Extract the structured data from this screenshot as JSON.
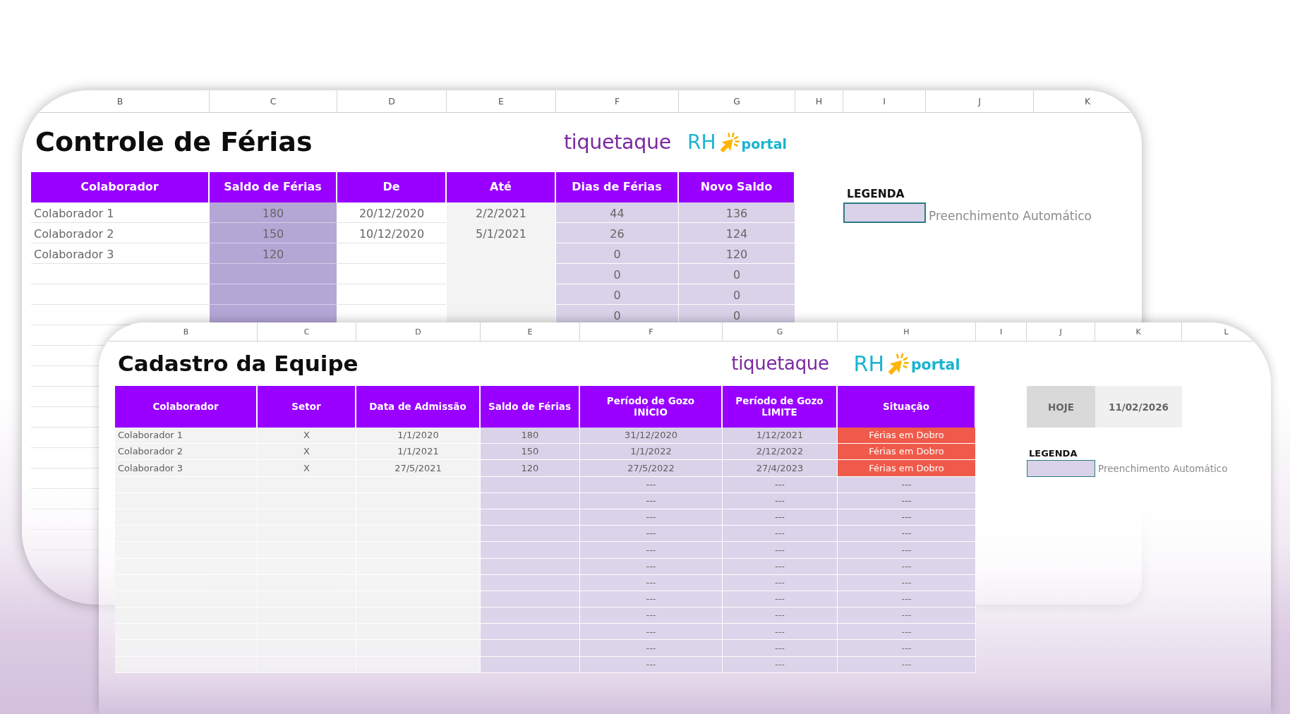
{
  "sheets": [
    {
      "kind": "vacation-balance",
      "column_letters": [
        "B",
        "C",
        "D",
        "E",
        "F",
        "G",
        "H",
        "I",
        "J",
        "K"
      ],
      "title": "Controle de Férias",
      "logos": [
        {
          "kind": "wordmark",
          "text": "tiquetaque"
        },
        {
          "kind": "badge",
          "prefix": "RH",
          "suffix": "portal"
        }
      ],
      "table": {
        "columns": [
          {
            "label": "Colaborador",
            "kind": "plain"
          },
          {
            "label": "Saldo de Férias",
            "kind": "input"
          },
          {
            "label": "De",
            "kind": "plain"
          },
          {
            "label": "Até",
            "kind": "muted"
          },
          {
            "label": "Dias de Férias",
            "kind": "auto"
          },
          {
            "label": "Novo Saldo",
            "kind": "auto"
          }
        ],
        "rows": [
          {
            "cells": [
              "Colaborador 1",
              "180",
              "20/12/2020",
              "2/2/2021",
              "44",
              "136"
            ]
          },
          {
            "cells": [
              "Colaborador 2",
              "150",
              "10/12/2020",
              "5/1/2021",
              "26",
              "124"
            ]
          },
          {
            "cells": [
              "Colaborador 3",
              "120",
              null,
              null,
              "0",
              "120"
            ]
          },
          {
            "cells": [
              null,
              null,
              null,
              null,
              "0",
              "0"
            ]
          },
          {
            "cells": [
              null,
              null,
              null,
              null,
              "0",
              "0"
            ]
          },
          {
            "cells": [
              null,
              null,
              null,
              null,
              "0",
              "0"
            ]
          }
        ]
      },
      "legend": {
        "title": "LEGENDA",
        "items": [
          {
            "kind": "auto",
            "label": "Preenchimento Automático"
          }
        ]
      }
    },
    {
      "kind": "team-register",
      "column_letters": [
        "B",
        "C",
        "D",
        "E",
        "F",
        "G",
        "H",
        "I",
        "J",
        "K",
        "L"
      ],
      "title": "Cadastro da Equipe",
      "logos": [
        {
          "kind": "wordmark",
          "text": "tiquetaque"
        },
        {
          "kind": "badge",
          "prefix": "RH",
          "suffix": "portal"
        }
      ],
      "table": {
        "columns": [
          {
            "label": "Colaborador",
            "kind": "muted"
          },
          {
            "label": "Setor",
            "kind": "muted"
          },
          {
            "label": "Data de Admissão",
            "kind": "muted"
          },
          {
            "label": "Saldo de Férias",
            "kind": "auto"
          },
          {
            "label": "Período de Gozo\nINÍCIO",
            "kind": "auto"
          },
          {
            "label": "Período de Gozo\nLIMITE",
            "kind": "auto"
          },
          {
            "label": "Situação",
            "kind": "status"
          }
        ],
        "rows": [
          {
            "cells": [
              "Colaborador 1",
              "X",
              "1/1/2020",
              "180",
              "31/12/2020",
              "1/12/2021",
              "Férias em Dobro"
            ],
            "alert": true
          },
          {
            "cells": [
              "Colaborador 2",
              "X",
              "1/1/2021",
              "150",
              "1/1/2022",
              "2/12/2022",
              "Férias em Dobro"
            ],
            "alert": true
          },
          {
            "cells": [
              "Colaborador 3",
              "X",
              "27/5/2021",
              "120",
              "27/5/2022",
              "27/4/2023",
              "Férias em Dobro"
            ],
            "alert": true
          },
          {
            "cells": [
              null,
              null,
              null,
              null,
              "---",
              "---",
              "---"
            ],
            "alert": false
          },
          {
            "cells": [
              null,
              null,
              null,
              null,
              "---",
              "---",
              "---"
            ],
            "alert": false
          },
          {
            "cells": [
              null,
              null,
              null,
              null,
              "---",
              "---",
              "---"
            ],
            "alert": false
          },
          {
            "cells": [
              null,
              null,
              null,
              null,
              "---",
              "---",
              "---"
            ],
            "alert": false
          },
          {
            "cells": [
              null,
              null,
              null,
              null,
              "---",
              "---",
              "---"
            ],
            "alert": false
          },
          {
            "cells": [
              null,
              null,
              null,
              null,
              "---",
              "---",
              "---"
            ],
            "alert": false
          },
          {
            "cells": [
              null,
              null,
              null,
              null,
              "---",
              "---",
              "---"
            ],
            "alert": false
          },
          {
            "cells": [
              null,
              null,
              null,
              null,
              "---",
              "---",
              "---"
            ],
            "alert": false
          },
          {
            "cells": [
              null,
              null,
              null,
              null,
              "---",
              "---",
              "---"
            ],
            "alert": false
          },
          {
            "cells": [
              null,
              null,
              null,
              null,
              "---",
              "---",
              "---"
            ],
            "alert": false
          },
          {
            "cells": [
              null,
              null,
              null,
              null,
              "---",
              "---",
              "---"
            ],
            "alert": false
          },
          {
            "cells": [
              null,
              null,
              null,
              null,
              "---",
              "---",
              "---"
            ],
            "alert": false
          }
        ]
      },
      "today": {
        "label": "HOJE",
        "value": "11/02/2026"
      },
      "legend": {
        "title": "LEGENDA",
        "items": [
          {
            "kind": "auto",
            "label": "Preenchimento Automático"
          }
        ]
      }
    }
  ]
}
